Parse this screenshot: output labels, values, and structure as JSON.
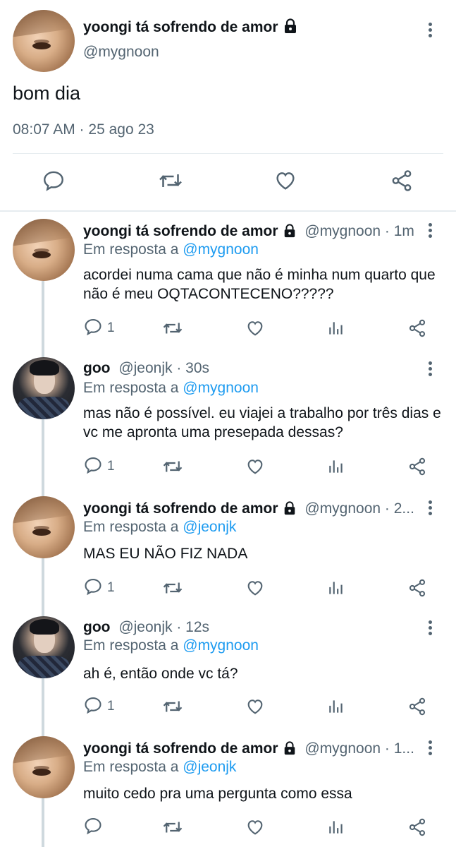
{
  "main_tweet": {
    "display_name": "yoongi tá sofrendo de amor",
    "handle": "@mygnoon",
    "text": "bom dia",
    "timestamp": "08:07 AM · 25 ago 23",
    "icons": [
      "reply-icon",
      "retweet-icon",
      "like-icon",
      "share-icon"
    ]
  },
  "replies": [
    {
      "display_name": "yoongi tá sofrendo de amor",
      "meta": "@mygnoon · 1m",
      "reply_prefix": "Em resposta a",
      "reply_to": "@mygnoon",
      "text": "acordei numa cama que não é minha num quarto que não é meu OQTACONTECENO?????",
      "reply_count": "1",
      "avatar": "warm"
    },
    {
      "display_name": "goo",
      "meta": "@jeonjk · 30s",
      "reply_prefix": "Em resposta a",
      "reply_to": "@mygnoon",
      "text": "mas não é possível. eu viajei a trabalho por três  dias e vc me apronta uma presepada dessas?",
      "reply_count": "1",
      "avatar": "dark"
    },
    {
      "display_name": "yoongi tá sofrendo de amor",
      "meta": "@mygnoon · 2...",
      "reply_prefix": "Em resposta a",
      "reply_to": "@jeonjk",
      "text": "MAS EU NÃO FIZ NADA",
      "reply_count": "1",
      "avatar": "warm"
    },
    {
      "display_name": "goo",
      "meta": "@jeonjk · 12s",
      "reply_prefix": "Em resposta a",
      "reply_to": "@mygnoon",
      "text": "ah é, então onde vc tá?",
      "reply_count": "1",
      "avatar": "dark"
    },
    {
      "display_name": "yoongi tá sofrendo de amor",
      "meta": "@mygnoon · 1...",
      "reply_prefix": "Em resposta a",
      "reply_to": "@jeonjk",
      "text": "muito cedo pra uma pergunta como essa",
      "reply_count": "",
      "avatar": "warm"
    }
  ],
  "colors": {
    "text": "#0f1419",
    "secondary": "#536471",
    "link": "#1d9bf0",
    "divider": "#e6ecf0",
    "thread_line": "#cfd9de"
  }
}
